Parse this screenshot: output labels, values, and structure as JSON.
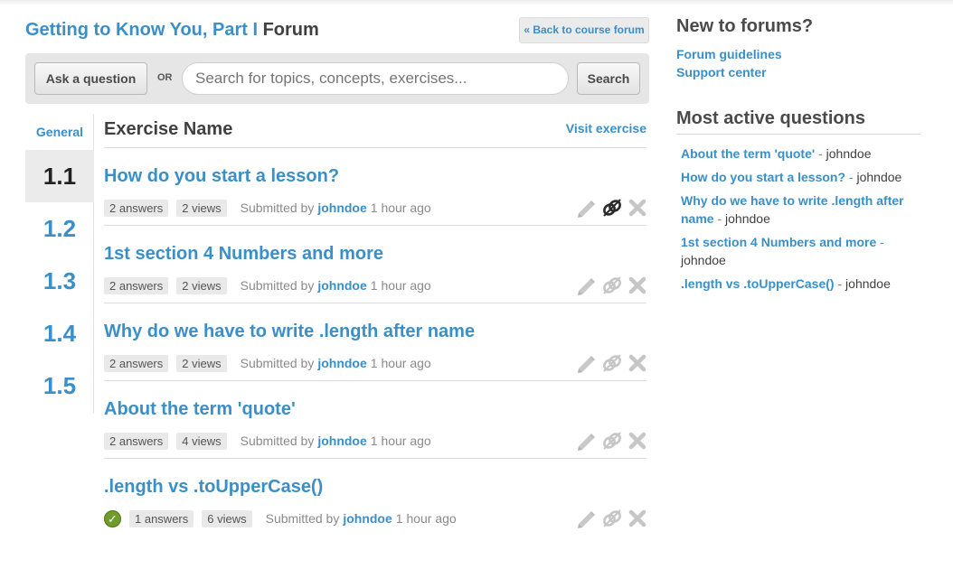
{
  "header": {
    "course_title": "Getting to Know You, Part I",
    "forum_word": "Forum",
    "back_label": "« Back to course forum"
  },
  "search": {
    "ask_label": "Ask a question",
    "or_label": "OR",
    "placeholder": "Search for topics, concepts, exercises...",
    "button_label": "Search"
  },
  "exercise_nav": {
    "general_label": "General",
    "items": [
      "1.1",
      "1.2",
      "1.3",
      "1.4",
      "1.5"
    ],
    "active": "1.1"
  },
  "list": {
    "header_label": "Exercise Name",
    "visit_label": "Visit exercise",
    "submitted_label": "Submitted by",
    "questions": [
      {
        "title": "How do you start a lesson?",
        "answers": "2 answers",
        "views": "2 views",
        "author": "johndoe",
        "time": "1 hour ago",
        "link_active": true,
        "accepted": false
      },
      {
        "title": "1st section 4 Numbers and more",
        "answers": "2 answers",
        "views": "2 views",
        "author": "johndoe",
        "time": "1 hour ago",
        "link_active": false,
        "accepted": false
      },
      {
        "title": "Why do we have to write .length after name",
        "answers": "2 answers",
        "views": "2 views",
        "author": "johndoe",
        "time": "1 hour ago",
        "link_active": false,
        "accepted": false
      },
      {
        "title": "About the term 'quote'",
        "answers": "2 answers",
        "views": "4 views",
        "author": "johndoe",
        "time": "1 hour ago",
        "link_active": false,
        "accepted": false
      },
      {
        "title": ".length vs .toUpperCase()",
        "answers": "1 answers",
        "views": "6 views",
        "author": "johndoe",
        "time": "1 hour ago",
        "link_active": false,
        "accepted": true
      }
    ],
    "icons": {
      "edit": "pencil-icon",
      "link": "chain-link-icon",
      "delete": "close-icon",
      "accepted": "checkmark-icon"
    }
  },
  "sidebar": {
    "new_title": "New to forums?",
    "links": [
      "Forum guidelines",
      "Support center"
    ],
    "active_title": "Most active questions",
    "active_questions": [
      {
        "title": "About the term 'quote'",
        "sep": " - ",
        "author": "johndoe"
      },
      {
        "title": "How do you start a lesson?",
        "sep": " - ",
        "author": "johndoe"
      },
      {
        "title": "Why do we have to write .length after name",
        "sep": " - ",
        "author": "johndoe"
      },
      {
        "title": "1st section 4 Numbers and more",
        "sep": " - ",
        "author": "johndoe"
      },
      {
        "title": ".length vs .toUpperCase()",
        "sep": " - ",
        "author": "johndoe"
      }
    ]
  },
  "colors": {
    "link": "#3a8fc8",
    "text": "#404040",
    "muted": "#8a8a8a",
    "accepted": "#6f9c2a",
    "icon_inactive": "#c4c4c4"
  }
}
